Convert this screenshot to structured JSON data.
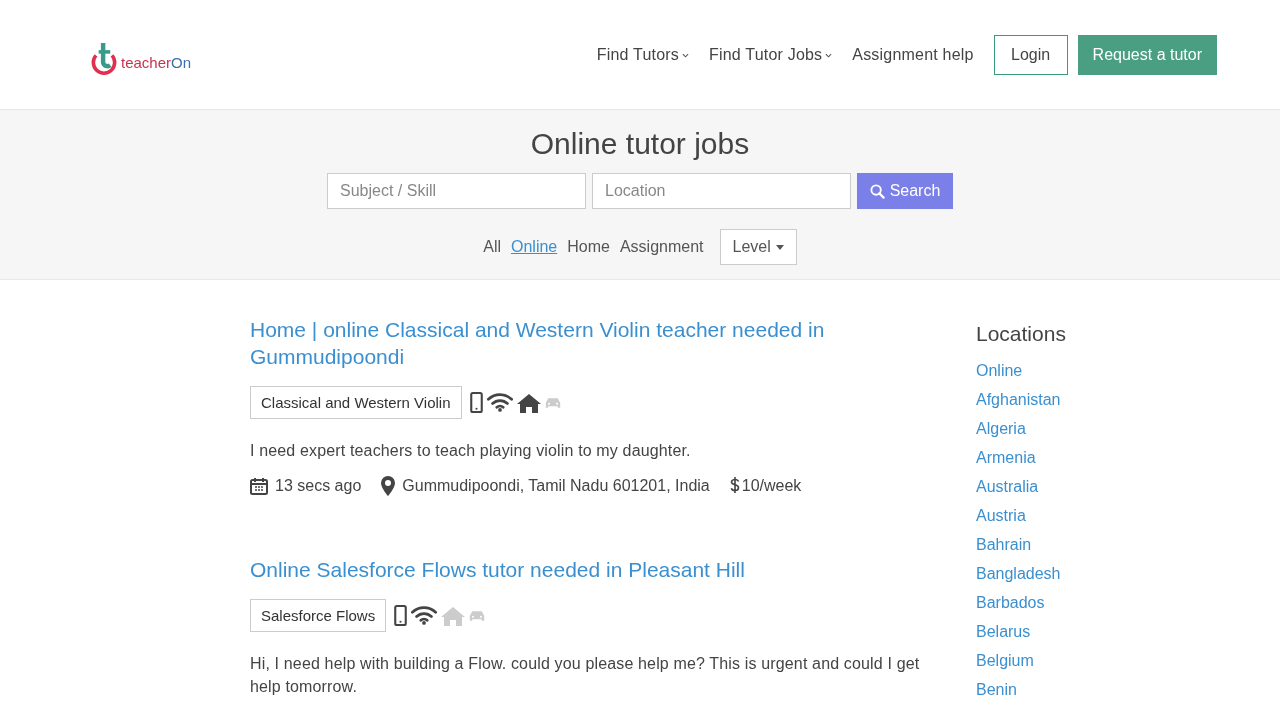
{
  "header": {
    "logo": {
      "word": "teacher",
      "accent": "On"
    },
    "nav": [
      {
        "label": "Find Tutors",
        "dropdown": true
      },
      {
        "label": "Find Tutor Jobs",
        "dropdown": true
      },
      {
        "label": "Assignment help",
        "dropdown": false
      }
    ],
    "login": "Login",
    "cta": "Request a tutor"
  },
  "search": {
    "title": "Online tutor jobs",
    "subject_placeholder": "Subject / Skill",
    "location_placeholder": "Location",
    "button": "Search",
    "filters": [
      {
        "label": "All",
        "selected": false
      },
      {
        "label": "Online",
        "selected": true
      },
      {
        "label": "Home",
        "selected": false
      },
      {
        "label": "Assignment",
        "selected": false
      }
    ],
    "level": "Level"
  },
  "jobs": [
    {
      "title": "Home | online Classical and Western Violin teacher needed in Gummudipoondi",
      "subject": "Classical and Western Violin",
      "modes": {
        "phone": true,
        "online": true,
        "home": true,
        "travel": false
      },
      "description": "I need expert teachers to teach playing violin to my daughter.",
      "posted": "13 secs ago",
      "location": "Gummudipoondi, Tamil Nadu 601201, India",
      "pay": "10/week"
    },
    {
      "title": "Online Salesforce Flows tutor needed in Pleasant Hill",
      "subject": "Salesforce Flows",
      "modes": {
        "phone": true,
        "online": true,
        "home": false,
        "travel": false
      },
      "description": "Hi, I need help with building a Flow. could you please help me? This is urgent and could I get help tomorrow."
    }
  ],
  "sidebar": {
    "title": "Locations",
    "items": [
      "Online",
      "Afghanistan",
      "Algeria",
      "Armenia",
      "Australia",
      "Austria",
      "Bahrain",
      "Bangladesh",
      "Barbados",
      "Belarus",
      "Belgium",
      "Benin"
    ]
  }
}
